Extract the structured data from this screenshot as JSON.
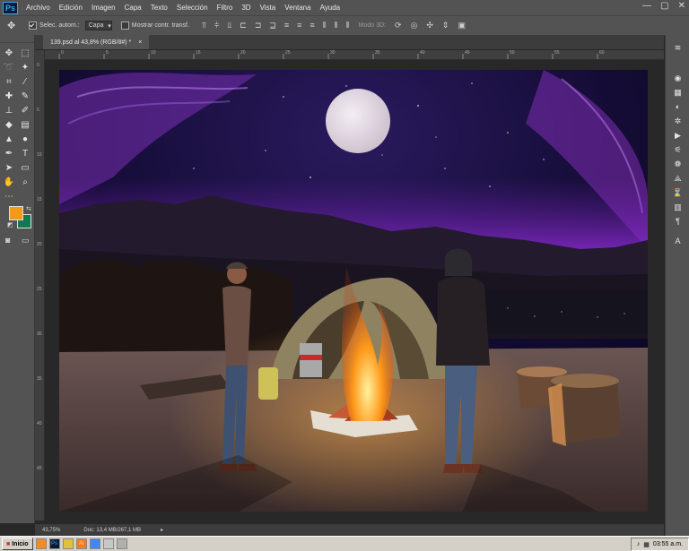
{
  "app": {
    "logo": "Ps"
  },
  "menu": [
    "Archivo",
    "Edición",
    "Imagen",
    "Capa",
    "Texto",
    "Selección",
    "Filtro",
    "3D",
    "Vista",
    "Ventana",
    "Ayuda"
  ],
  "window_controls": [
    "—",
    "▢",
    "✕"
  ],
  "options": {
    "auto_select_label": "Selec. autom.:",
    "auto_select_value": "Capa",
    "show_transform_label": "Mostrar contr. transf.",
    "mode3d_label": "Modo 3D:"
  },
  "document_tab": {
    "title": "139.psd al 43,8% (RGB/8#) *",
    "close": "×"
  },
  "ruler_h_ticks": [
    "0",
    "5",
    "10",
    "15",
    "20",
    "25",
    "30",
    "35",
    "40",
    "45",
    "50",
    "55",
    "60"
  ],
  "ruler_v_ticks": [
    "0",
    "5",
    "10",
    "15",
    "20",
    "25",
    "30",
    "35",
    "40",
    "45"
  ],
  "status": {
    "zoom": "43,75%",
    "doc": "Doc: 13,4 MB/267,1 MB"
  },
  "colors": {
    "foreground": "#f39a1b",
    "background": "#0f7a52"
  },
  "icons": {
    "toolbox": [
      "move-icon",
      "marquee-icon",
      "lasso-icon",
      "magic-wand-icon",
      "crop-icon",
      "eyedropper-icon",
      "healing-icon",
      "brush-icon",
      "stamp-icon",
      "history-brush-icon",
      "eraser-icon",
      "gradient-icon",
      "blur-icon",
      "dodge-icon",
      "pen-icon",
      "type-icon",
      "path-select-icon",
      "shape-icon",
      "hand-icon",
      "zoom-icon"
    ],
    "right": [
      "layers-icon",
      "color-icon",
      "swatches-icon",
      "adjustments-icon",
      "styles-icon",
      "actions-icon",
      "properties-icon",
      "channels-icon",
      "paths-icon",
      "history-icon",
      "libraries-icon",
      "paragraph-icon",
      "character-icon"
    ]
  },
  "taskbar": {
    "start": "Inicio",
    "clock": "03:55 a.m."
  }
}
